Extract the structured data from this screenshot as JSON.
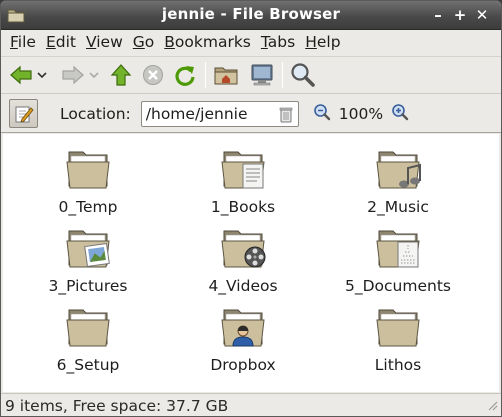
{
  "window": {
    "title": "jennie - File Browser"
  },
  "titlebar": {
    "minimize": "–",
    "maximize": "+",
    "close": "✕"
  },
  "menu": {
    "items": [
      {
        "u": "F",
        "rest": "ile"
      },
      {
        "u": "E",
        "rest": "dit"
      },
      {
        "u": "V",
        "rest": "iew"
      },
      {
        "u": "G",
        "rest": "o"
      },
      {
        "u": "B",
        "rest": "ookmarks"
      },
      {
        "u": "T",
        "rest": "abs"
      },
      {
        "u": "H",
        "rest": "elp"
      }
    ]
  },
  "location": {
    "label": "Location:",
    "value": "/home/jennie"
  },
  "zoom": {
    "level": "100%"
  },
  "files": [
    {
      "name": "0_Temp",
      "emblem": "none"
    },
    {
      "name": "1_Books",
      "emblem": "document"
    },
    {
      "name": "2_Music",
      "emblem": "music"
    },
    {
      "name": "3_Pictures",
      "emblem": "picture"
    },
    {
      "name": "4_Videos",
      "emblem": "film"
    },
    {
      "name": "5_Documents",
      "emblem": "document"
    },
    {
      "name": "6_Setup",
      "emblem": "none"
    },
    {
      "name": "Dropbox",
      "emblem": "person"
    },
    {
      "name": "Lithos",
      "emblem": "none"
    }
  ],
  "status": {
    "text": "9 items, Free space: 37.7 GB"
  },
  "colors": {
    "titlebar": "#4a4a4a",
    "window_bg": "#eceae6",
    "folder": "#c9bd9a",
    "arrow_green": "#4e9a06"
  }
}
